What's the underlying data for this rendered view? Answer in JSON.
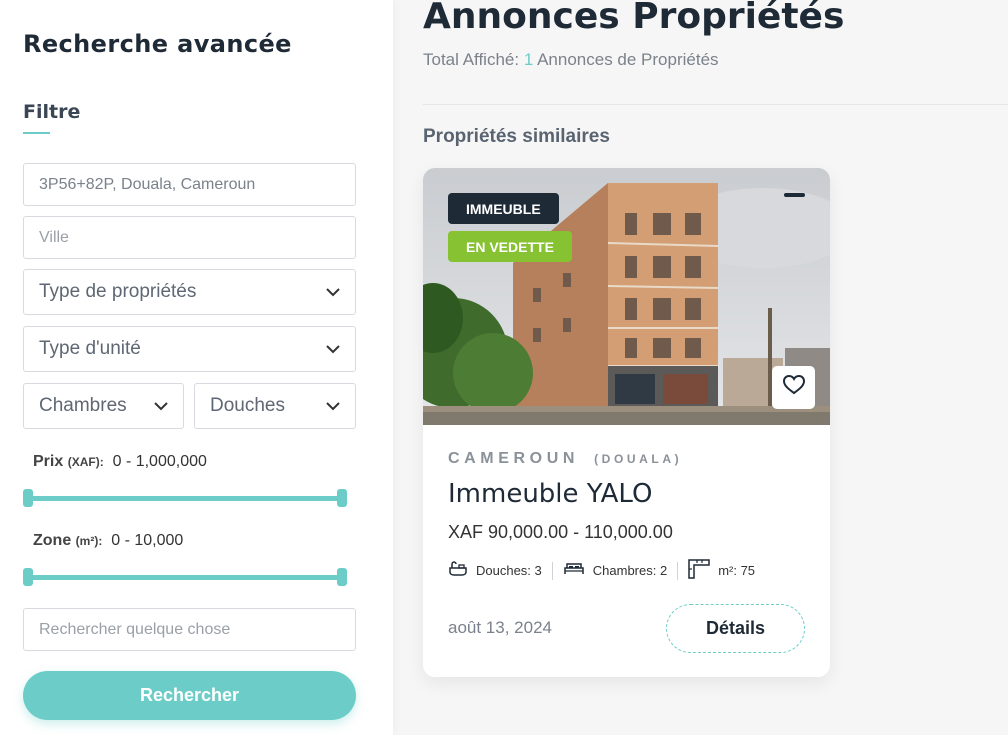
{
  "sidebar": {
    "title": "Recherche avancée",
    "filter_label": "Filtre",
    "address_value": "3P56+82P, Douala, Cameroun",
    "city_placeholder": "Ville",
    "property_type": "Type de propriétés",
    "unit_type": "Type d'unité",
    "bedrooms": "Chambres",
    "showers": "Douches",
    "price": {
      "label": "Prix",
      "unit": "(XAF):",
      "range": "0 - 1,000,000",
      "min": 0,
      "max": 1000000
    },
    "area": {
      "label": "Zone",
      "unit": "(m²):",
      "range": "0 - 10,000",
      "min": 0,
      "max": 10000
    },
    "keyword_placeholder": "Rechercher quelque chose",
    "search_button": "Rechercher"
  },
  "main": {
    "title": "Annonces Propriétés",
    "total_prefix": "Total Affiché:",
    "total_count": "1",
    "total_suffix": "Annonces de Propriétés",
    "similar_heading": "Propriétés similaires"
  },
  "card": {
    "badge_type": "IMMEUBLE",
    "badge_featured": "EN VEDETTE",
    "country": "CAMEROUN",
    "city": "(DOUALA)",
    "name": "Immeuble YALO",
    "price": "XAF 90,000.00 - 110,000.00",
    "showers": "Douches: 3",
    "bedrooms": "Chambres: 2",
    "area": "m²: 75",
    "date": "août 13, 2024",
    "details_button": "Détails"
  },
  "colors": {
    "accent": "#6ccdc8",
    "dark": "#1f2a37",
    "featured": "#86c232"
  },
  "icons": [
    "chevron-down-icon",
    "heart-icon",
    "bathtub-icon",
    "bed-icon",
    "area-icon",
    "menu-dash-icon"
  ]
}
